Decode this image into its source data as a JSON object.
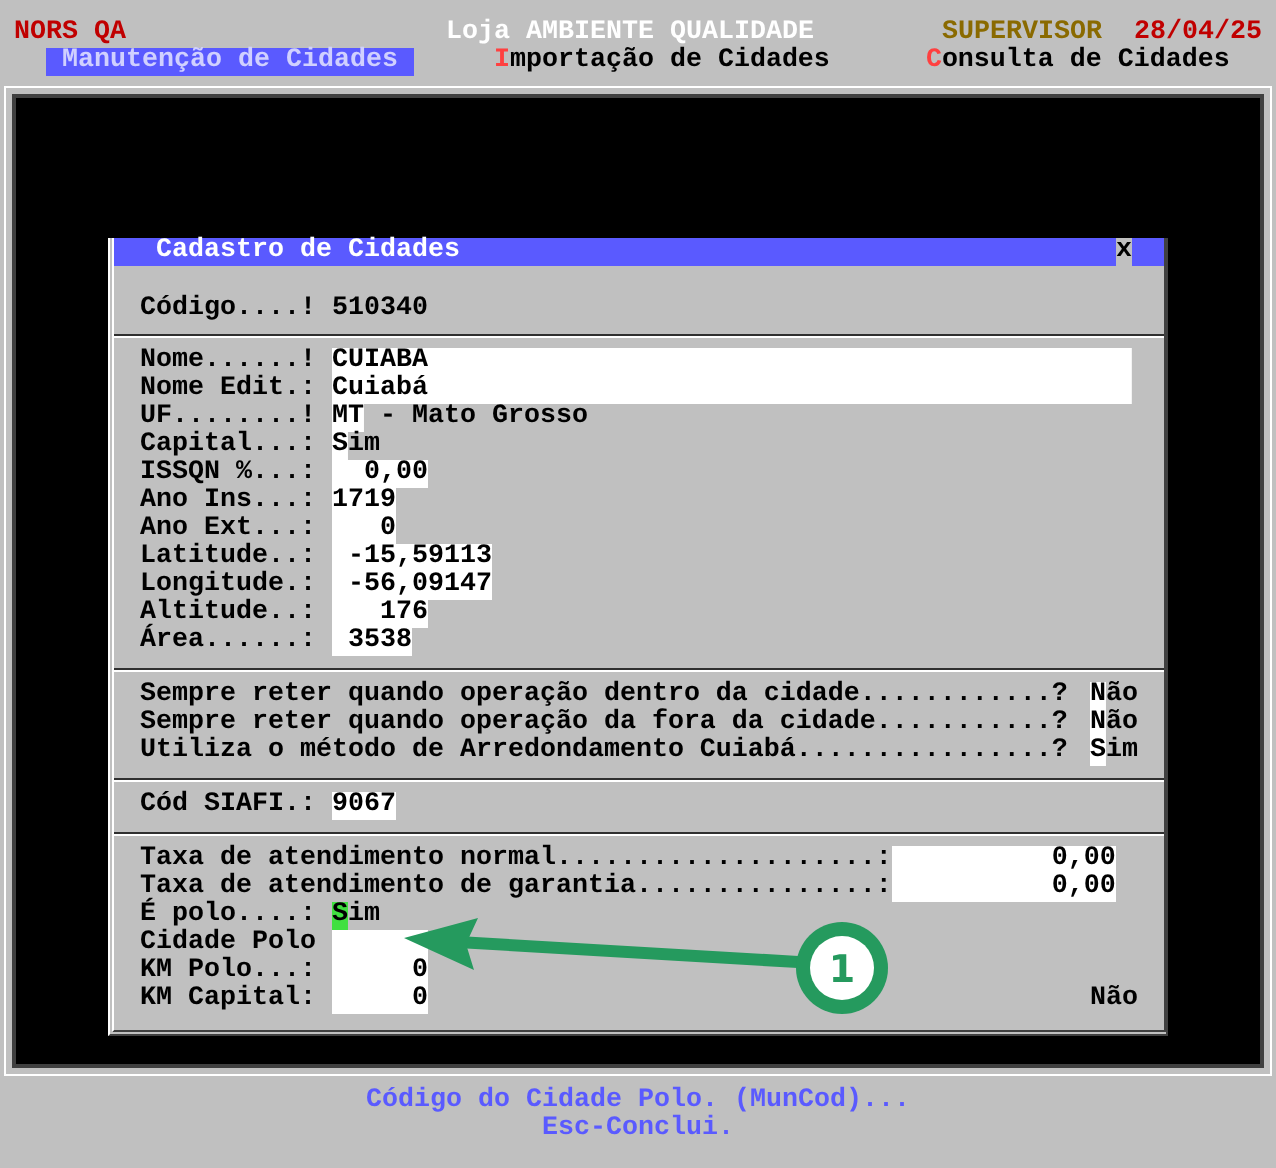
{
  "header": {
    "company": "NORS QA",
    "store": "Loja AMBIENTE QUALIDADE",
    "user": "SUPERVISOR",
    "date": "28/04/25"
  },
  "menu": [
    {
      "hotkey": "M",
      "rest": "anutenção de Cidades",
      "selected": true
    },
    {
      "hotkey": "I",
      "rest": "mportação de Cidades",
      "selected": false
    },
    {
      "hotkey": "C",
      "rest": "onsulta de Cidades",
      "selected": false
    }
  ],
  "dialog": {
    "title": "Cadastro de Cidades",
    "close": "x",
    "code": {
      "label": "Código....!",
      "value": "510340"
    },
    "fields": [
      {
        "label": "Nome......!",
        "value": "CUIABA"
      },
      {
        "label": "Nome Edit.:",
        "value": "Cuiabá"
      },
      {
        "label": "UF........!",
        "value": "MT",
        "description": "- Mato Grosso"
      },
      {
        "label": "Capital...:",
        "value": "Sim"
      },
      {
        "label": "ISSQN %...:",
        "value": "0,00"
      },
      {
        "label": "Ano Ins...:",
        "value": "1719"
      },
      {
        "label": "Ano Ext...:",
        "value": "0"
      },
      {
        "label": "Latitude..:",
        "value": "-15,59113"
      },
      {
        "label": "Longitude.:",
        "value": "-56,09147"
      },
      {
        "label": "Altitude..:",
        "value": "176"
      },
      {
        "label": "Área......:",
        "value": "3538"
      }
    ],
    "options": [
      {
        "label": "Sempre reter quando operação dentro da cidade............?",
        "value": "Não"
      },
      {
        "label": "Sempre reter quando operação da fora da cidade...........?",
        "value": "Não"
      },
      {
        "label": "Utiliza o método de Arredondamento Cuiabá................?",
        "value": "Sim"
      }
    ],
    "siafi": {
      "label": "Cód SIAFI.:",
      "value": "9067"
    },
    "fees": [
      {
        "label": "Taxa de atendimento normal....................:",
        "value": "0,00"
      },
      {
        "label": "Taxa de atendimento de garantia...............:",
        "value": "0,00"
      }
    ],
    "polo": [
      {
        "label": "É polo....:",
        "value": "Sim",
        "cursor": true
      },
      {
        "label": "Cidade Polo",
        "cursor": false
      },
      {
        "label": "KM Polo...:",
        "value": "0",
        "cursor": false
      },
      {
        "label": "KM Capital:",
        "value": "0",
        "note": "Não",
        "cursor": false
      }
    ]
  },
  "callout": {
    "number": "1"
  },
  "footer": [
    "Código do Cidade Polo. (MunCod)...",
    "Esc-Conclui."
  ]
}
